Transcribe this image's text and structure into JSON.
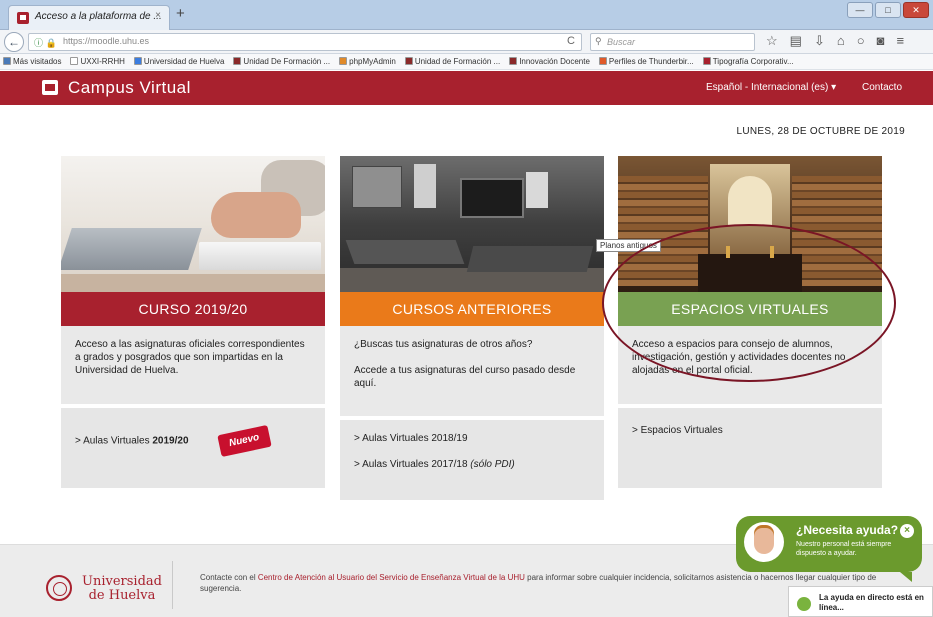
{
  "browser": {
    "tab_title": "Acceso a la plataforma de ...",
    "tab_close": "×",
    "new_tab": "+",
    "url": "https://moodle.uhu.es",
    "search_placeholder": "Buscar",
    "reload": "C",
    "win_min": "—",
    "win_max": "□",
    "win_close": "✕",
    "icons": [
      "star-icon",
      "library-icon",
      "download-icon",
      "home-icon",
      "sync-icon",
      "pocket-icon",
      "menu-icon"
    ],
    "icon_glyphs": [
      "☆",
      "▤",
      "⇩",
      "⌂",
      "○",
      "◙",
      "≡"
    ]
  },
  "bookmarks": [
    {
      "label": "Más visitados",
      "color": "#4a7ab8"
    },
    {
      "label": "UXXI-RRHH",
      "color": "#ffffff"
    },
    {
      "label": "Universidad de Huelva",
      "color": "#3b7de0"
    },
    {
      "label": "Unidad De Formación ...",
      "color": "#8a2a2a"
    },
    {
      "label": "phpMyAdmin",
      "color": "#e08a2a"
    },
    {
      "label": "Unidad de Formación ...",
      "color": "#8a2a2a"
    },
    {
      "label": "Innovación Docente",
      "color": "#8a2a2a"
    },
    {
      "label": "Perfiles de Thunderbir...",
      "color": "#e05a2a"
    },
    {
      "label": "Tipografía Corporativ...",
      "color": "#a8212e"
    }
  ],
  "header": {
    "brand": "Campus Virtual",
    "language": "Español - Internacional (es) ▾",
    "contact": "Contacto",
    "accent": "#a8212e"
  },
  "date": "LUNES, 28 DE OCTUBRE DE 2019",
  "cards": [
    {
      "title": "CURSO 2019/20",
      "band_color": "#a8212e",
      "description": "Acceso a las asignaturas oficiales correspondientes a grados y posgrados que son impartidas en la Universidad de Huelva.",
      "links": [
        {
          "prefix": "> Aulas Virtuales ",
          "bold": "2019/20",
          "suffix": ""
        }
      ],
      "badge": "Nuevo"
    },
    {
      "title": "CURSOS ANTERIORES",
      "band_color": "#ea7a1a",
      "description_line1": "¿Buscas tus asignaturas de otros años?",
      "description_line2": "Accede a tus asignaturas del curso pasado desde aquí.",
      "links": [
        {
          "text": "> Aulas Virtuales 2018/19"
        },
        {
          "text": "> Aulas Virtuales 2017/18 ",
          "italic": "(sólo PDI)"
        }
      ]
    },
    {
      "title": "ESPACIOS VIRTUALES",
      "band_color": "#79a152",
      "description": "Acceso a espacios para consejo de alumnos, investigación, gestión y actividades docentes no alojadas en el portal oficial.",
      "links": [
        {
          "text": "> Espacios Virtuales"
        }
      ],
      "tooltip": "Planos antiguos"
    }
  ],
  "footer": {
    "university_line1": "Universidad",
    "university_line2": "de Huelva",
    "text_before": "Contacte con el ",
    "link_text": "Centro de Atención al Usuario del Servicio de Enseñanza Virtual de la UHU",
    "text_after": " para informar sobre cualquier incidencia, solicitarnos asistencia o hacernos llegar cualquier tipo de sugerencia."
  },
  "help": {
    "title": "¿Necesita ayuda?",
    "subtitle": "Nuestro personal está siempre dispuesto a ayudar.",
    "close": "×",
    "live": "La ayuda en directo está en línea..."
  }
}
